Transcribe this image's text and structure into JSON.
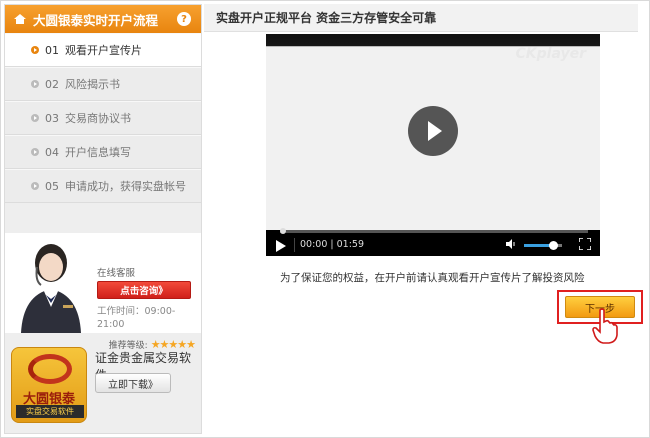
{
  "sidebar": {
    "title": "大圆银泰实时开户流程",
    "help_glyph": "?",
    "steps": [
      {
        "num": "01",
        "label": "观看开户宣传片",
        "active": true
      },
      {
        "num": "02",
        "label": "风险揭示书",
        "active": false
      },
      {
        "num": "03",
        "label": "交易商协议书",
        "active": false
      },
      {
        "num": "04",
        "label": "开户信息填写",
        "active": false
      },
      {
        "num": "05",
        "label": "申请成功，获得实盘帐号",
        "active": false
      }
    ]
  },
  "service": {
    "label": "在线客服",
    "consult_button": "点击咨询》",
    "work_time": "工作时间：09:00-21:00",
    "rating_label": "推荐等级:",
    "stars": 5
  },
  "app": {
    "logo_brand": "大圆银泰",
    "logo_sub": "实盘交易软件",
    "name": "证金贵金属交易软件",
    "download_button": "立即下载》"
  },
  "main": {
    "title": "实盘开户正规平台 资金三方存管安全可靠",
    "notice": "为了保证您的权益，在开户前请认真观看开户宣传片了解投资风险",
    "next_button": "下一步"
  },
  "player": {
    "watermark": "CKplayer",
    "time": "00:00 | 01:59",
    "progress": 0.0,
    "volume": 0.75
  },
  "colors": {
    "accent": "#e8850f",
    "highlight_box": "#e02020",
    "consult_red": "#d0201a"
  }
}
